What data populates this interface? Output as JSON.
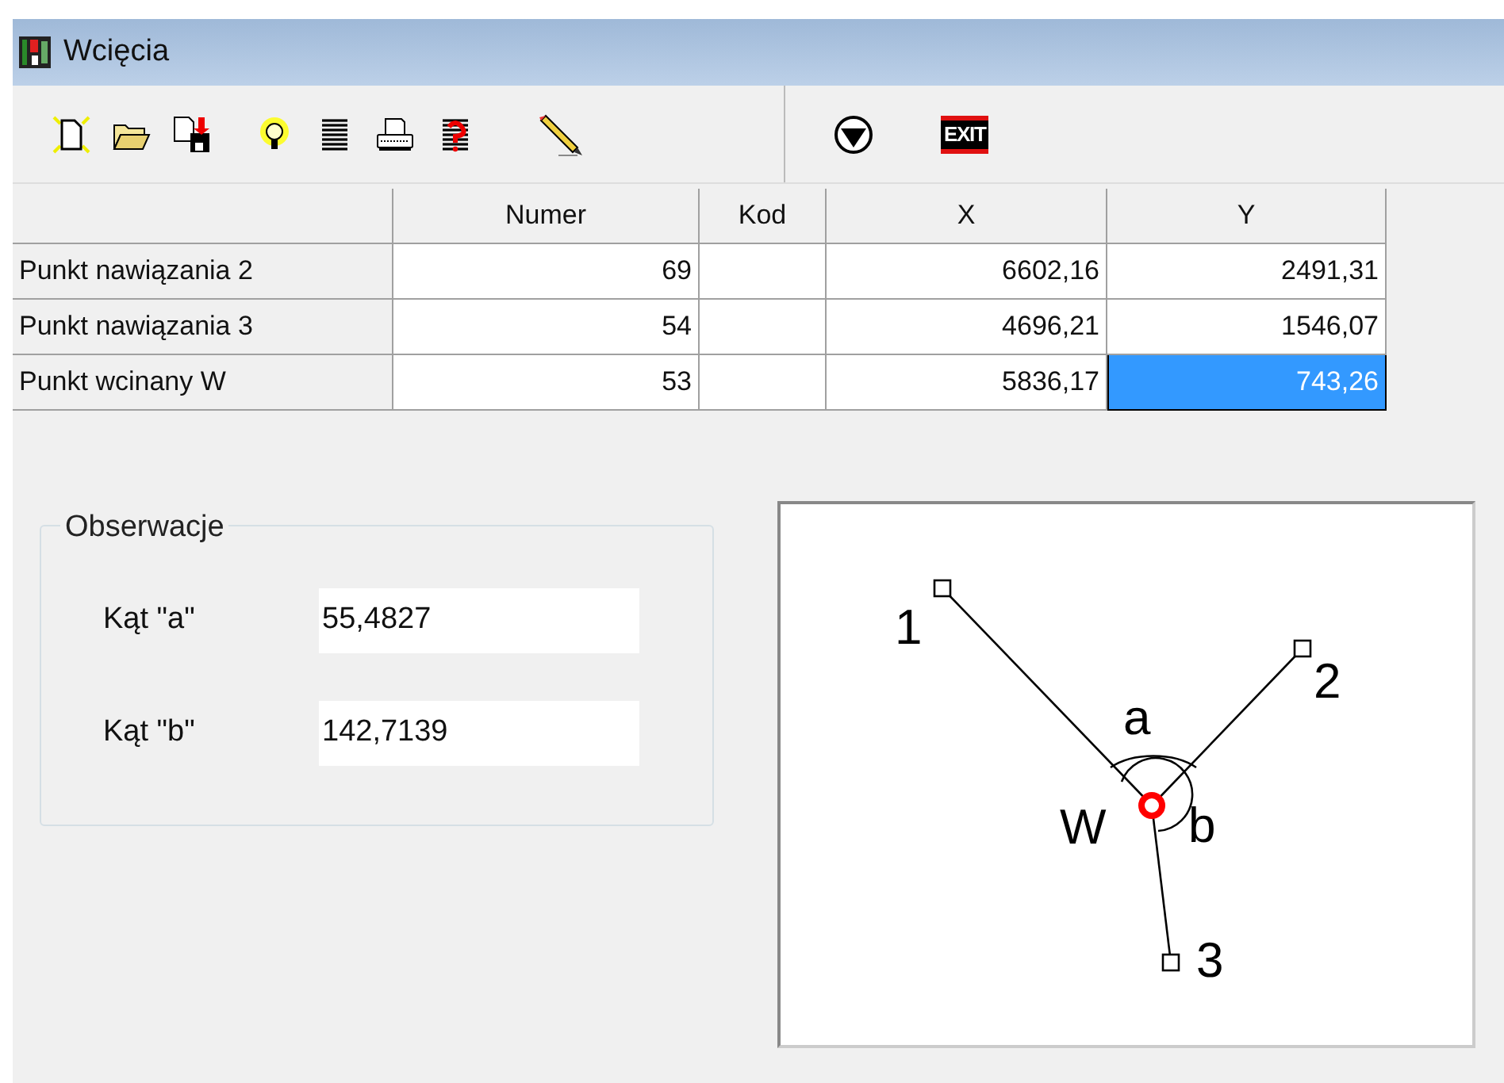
{
  "window": {
    "title": "Wcięcia"
  },
  "toolbar": {
    "exit_button": {
      "label": "EXIT"
    }
  },
  "table": {
    "columns": [
      "Numer",
      "Kod",
      "X",
      "Y"
    ],
    "rows": [
      {
        "label": "Punkt nawiązania 2",
        "cells": [
          {
            "text": "69",
            "selected": false
          },
          {
            "selected": false
          },
          {
            "text": "6602,16",
            "selected": false
          },
          {
            "text": "2491,31",
            "selected": false
          }
        ]
      },
      {
        "label": "Punkt nawiązania 3",
        "cells": [
          {
            "text": "54",
            "selected": false
          },
          {
            "selected": false
          },
          {
            "text": "4696,21",
            "selected": false
          },
          {
            "text": "1546,07",
            "selected": false
          }
        ]
      },
      {
        "label": "Punkt wcinany W",
        "cells": [
          {
            "text": "53",
            "selected": false
          },
          {
            "selected": false
          },
          {
            "text": "5836,17",
            "selected": false
          },
          {
            "text": "743,26",
            "selected": true
          }
        ]
      }
    ]
  },
  "observations": {
    "title": "Obserwacje",
    "fields": [
      {
        "label": "Kąt \"a\"",
        "value": "55,4827"
      },
      {
        "label": "Kąt \"b\"",
        "value": "142,7139"
      }
    ]
  },
  "diagram": {
    "points": [
      {
        "label": "1"
      },
      {
        "label": "2"
      },
      {
        "label": "3"
      }
    ],
    "station": {
      "label": "W"
    },
    "angles": [
      {
        "label": "a"
      },
      {
        "label": "b"
      }
    ]
  }
}
